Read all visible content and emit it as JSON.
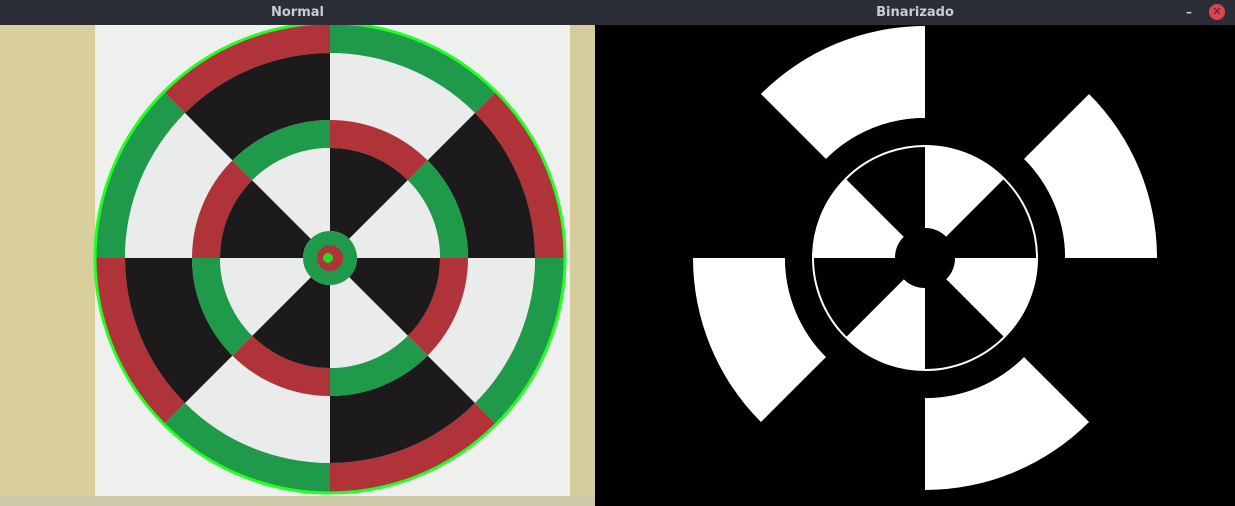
{
  "windows": {
    "normal": {
      "title": "Normal"
    },
    "binarizado": {
      "title": "Binarizado",
      "minimize_symbol": "–",
      "close_symbol": "✕"
    }
  },
  "colors": {
    "titlebar": "#2b2e37",
    "title_text": "#c9ccd4",
    "red": "#b0333a",
    "green": "#1f9a4a",
    "black": "#1c1a1a",
    "white": "#e9ecea",
    "paper": "#eef0ee",
    "wall": "#e3dcb0",
    "detect_outline": "#22ff22",
    "close_button": "#e0434d"
  },
  "icons": {
    "minimize": "minimize-icon",
    "close": "close-icon"
  }
}
